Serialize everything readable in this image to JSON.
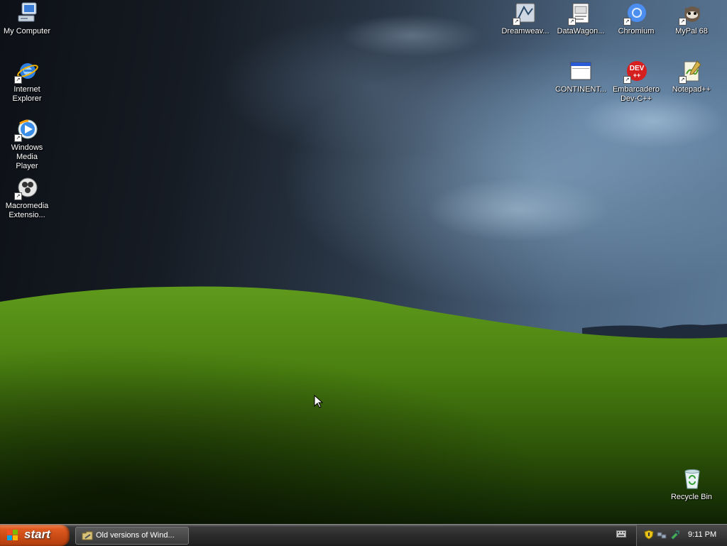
{
  "desktop": {
    "icons_left": [
      {
        "label": "My Computer",
        "icon": "computer-icon"
      },
      {
        "label": "Internet\nExplorer",
        "icon": "internet-explorer-icon"
      },
      {
        "label": "Windows Media\nPlayer",
        "icon": "media-player-icon"
      },
      {
        "label": "Macromedia\nExtensio...",
        "icon": "macromedia-extension-icon"
      }
    ],
    "icons_right": [
      {
        "label": "Dreamweav...",
        "icon": "dreamweaver-icon"
      },
      {
        "label": "DataWagon...",
        "icon": "datawagon-icon"
      },
      {
        "label": "Chromium",
        "icon": "chromium-icon"
      },
      {
        "label": "MyPal 68",
        "icon": "mypal-icon"
      },
      {
        "label": "CONTINENT...",
        "icon": "continent-window-icon"
      },
      {
        "label": "Embarcadero\nDev-C++",
        "icon": "devcpp-icon"
      },
      {
        "label": "Notepad++",
        "icon": "notepadpp-icon"
      }
    ],
    "recycle_bin": {
      "label": "Recycle Bin",
      "icon": "recycle-bin-icon"
    }
  },
  "taskbar": {
    "start_label": "start",
    "task": {
      "label": "Old versions of Wind...",
      "icon": "folder-tools-icon"
    },
    "clock": "9:11 PM",
    "tray_icons": [
      "security-shield-icon",
      "network-icon",
      "safely-remove-icon"
    ]
  },
  "colors": {
    "start_button": "#de5a21",
    "taskbar": "#2b2b2b",
    "hill_green": "#4f8a10"
  }
}
